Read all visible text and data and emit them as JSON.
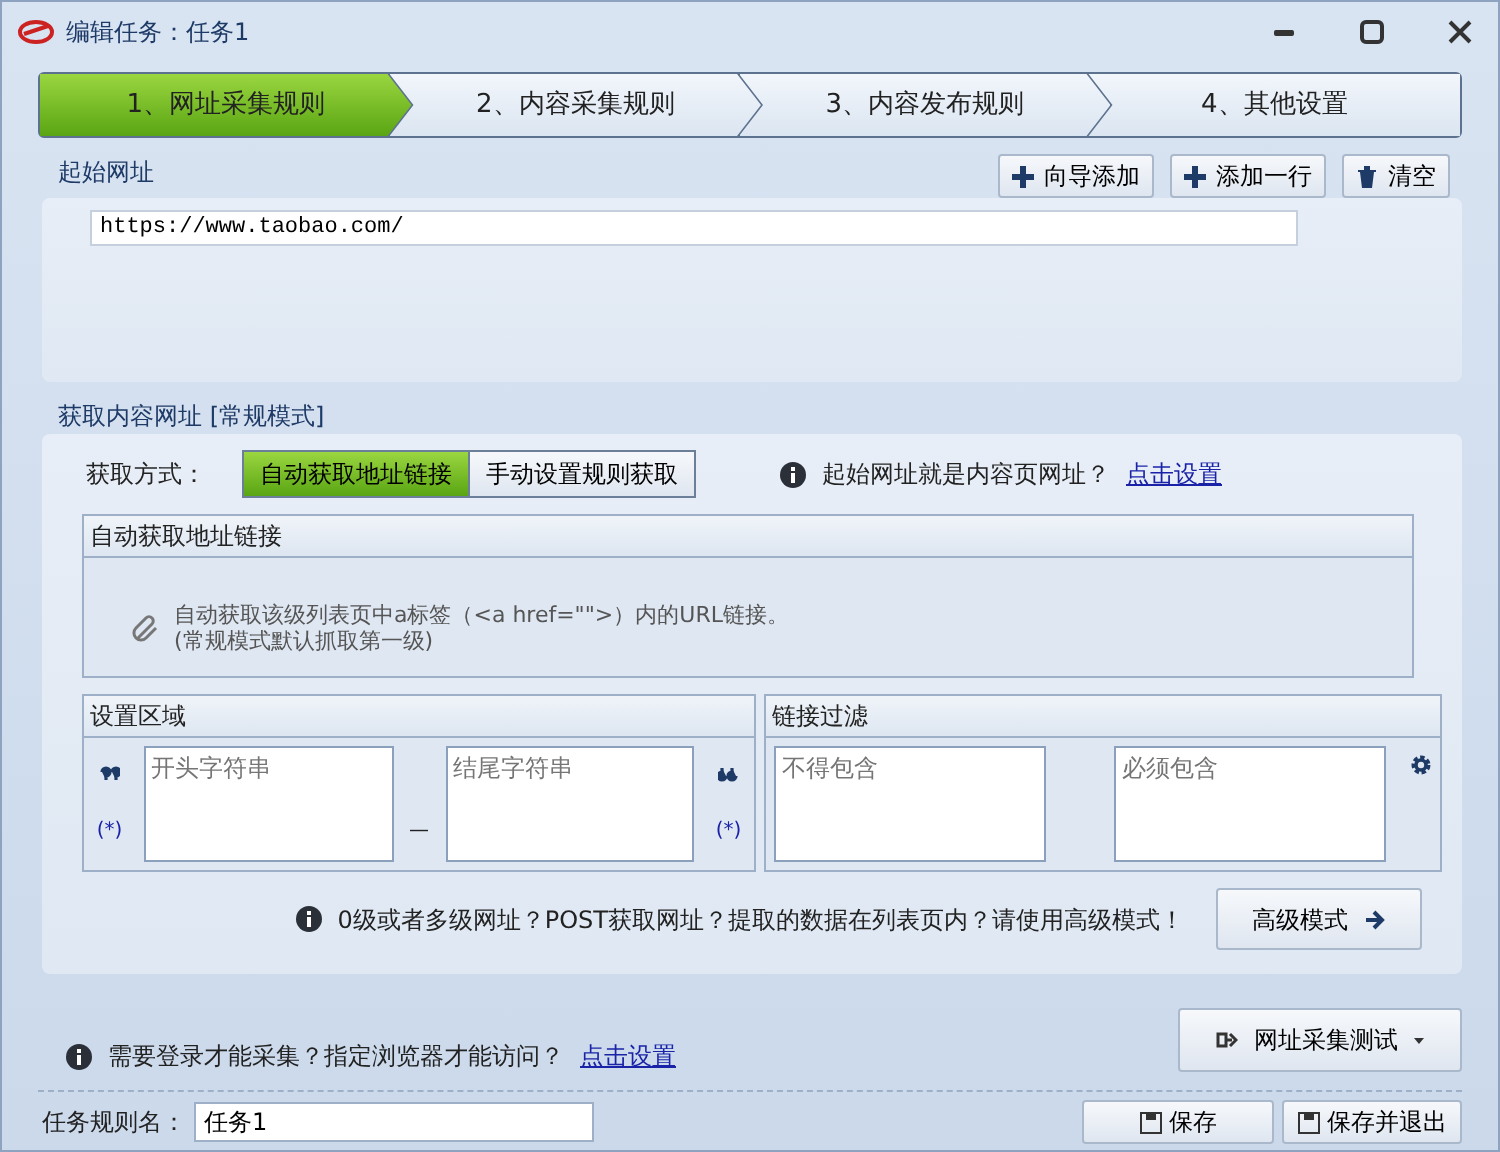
{
  "window": {
    "title": "编辑任务：任务1"
  },
  "steps": [
    {
      "label": "1、网址采集规则",
      "selected": true
    },
    {
      "label": "2、内容采集规则",
      "selected": false
    },
    {
      "label": "3、内容发布规则",
      "selected": false
    },
    {
      "label": "4、其他设置",
      "selected": false
    }
  ],
  "start_url": {
    "title": "起始网址",
    "buttons": [
      {
        "label": "向导添加",
        "kind": "plus"
      },
      {
        "label": "添加一行",
        "kind": "plus"
      },
      {
        "label": "清空",
        "kind": "trash"
      }
    ],
    "value": "https://www.taobao.com/"
  },
  "content_url": {
    "title": "获取内容网址 [常规模式]",
    "method_label": "获取方式：",
    "methods": [
      {
        "label": "自动获取地址链接",
        "selected": true
      },
      {
        "label": "手动设置规则获取",
        "selected": false
      }
    ],
    "hint": "起始网址就是内容页网址？",
    "hint_link": "点击设置",
    "auto_box": {
      "title": "自动获取地址链接",
      "lines": [
        "自动获取该级列表页中a标签（<a href=\"\">）内的URL链接。",
        "(常规模式默认抓取第一级)"
      ]
    },
    "region": {
      "title": "设置区域",
      "start_placeholder": "开头字符串",
      "end_placeholder": "结尾字符串",
      "separator": "—",
      "wildcard_left": "(*)",
      "wildcard_right": "(*)"
    },
    "filter": {
      "title": "链接过滤",
      "exclude_placeholder": "不得包含",
      "include_placeholder": "必须包含"
    },
    "advanced_hint": "0级或者多级网址？POST获取网址？提取的数据在列表页内？请使用高级模式！",
    "advanced_button": "高级模式"
  },
  "login_hint": "需要登录才能采集？指定浏览器才能访问？",
  "login_link": "点击设置",
  "test_button": "网址采集测试",
  "rule_name": {
    "label": "任务规则名：",
    "value": "任务1"
  },
  "save_buttons": [
    "保存",
    "保存并退出"
  ]
}
